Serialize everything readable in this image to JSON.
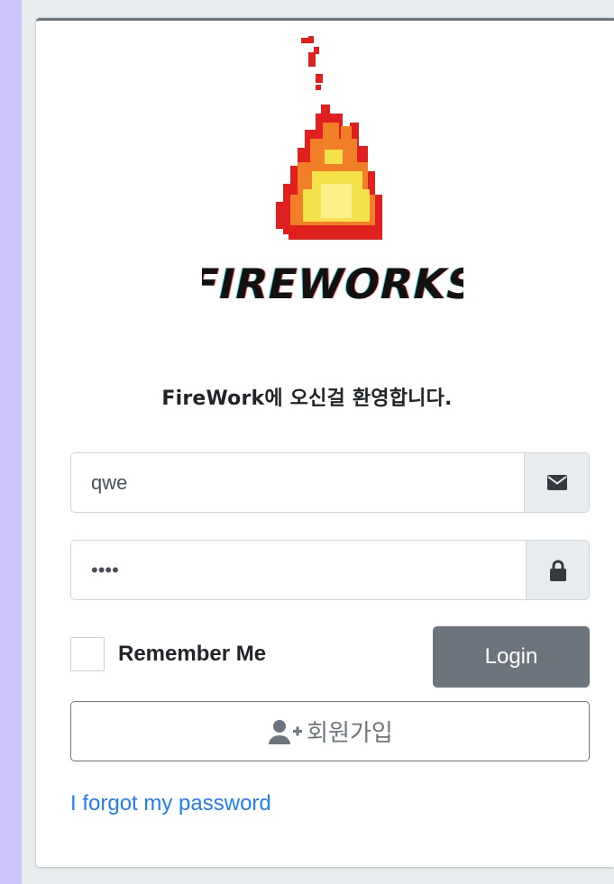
{
  "brand": {
    "name": "FIREWORKS",
    "welcome_text": "FireWork에 오신걸 환영합니다."
  },
  "form": {
    "email_value": "qwe",
    "password_value": "••••",
    "remember_label": "Remember Me",
    "login_label": "Login",
    "signup_label": "회원가입",
    "forgot_label": "I forgot my password"
  },
  "icons": {
    "email": "envelope-icon",
    "password": "lock-icon",
    "signup": "user-plus-icon",
    "logo": "pixel-fire-icon"
  },
  "colors": {
    "page_bg": "#ccc3fa",
    "card_bg": "#ffffff",
    "button_secondary": "#6c757d",
    "link": "#1f7ef5",
    "flame_outer": "#e0201f",
    "flame_mid": "#f07f27",
    "flame_inner": "#f5e14a"
  }
}
